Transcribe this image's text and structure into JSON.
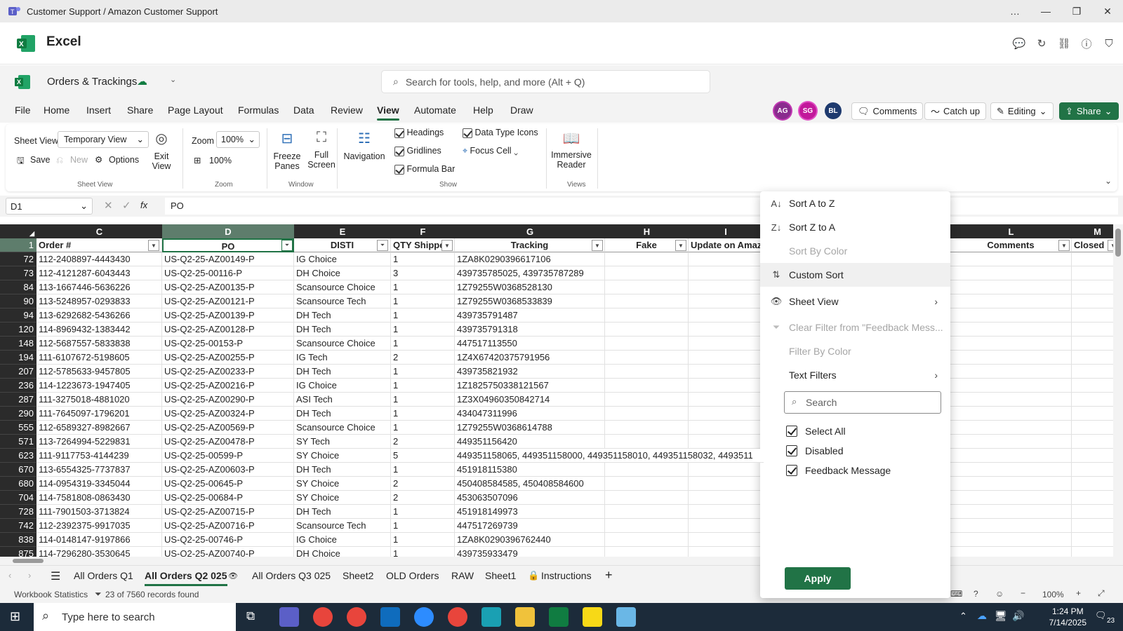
{
  "window": {
    "title": "Customer Support / Amazon Customer Support",
    "controls": [
      "…",
      "—",
      "❐",
      "✕"
    ]
  },
  "app": {
    "name": "Excel"
  },
  "doc": {
    "name": "Orders & Trackings",
    "search_placeholder": "Search for tools, help, and more (Alt + Q)"
  },
  "menu": [
    "File",
    "Home",
    "Insert",
    "Share",
    "Page Layout",
    "Formulas",
    "Data",
    "Review",
    "View",
    "Automate",
    "Help",
    "Draw"
  ],
  "menu_active": "View",
  "avatars": [
    {
      "initials": "AG",
      "color": "#8a2c8e"
    },
    {
      "initials": "SG",
      "color": "#c2199b"
    },
    {
      "initials": "BL",
      "color": "#1e3a6e"
    }
  ],
  "top_buttons": {
    "comments": "Comments",
    "catchup": "Catch up",
    "editing": "Editing",
    "share": "Share"
  },
  "ribbon": {
    "sheet_view_label": "Sheet View",
    "sheet_view_value": "Temporary View",
    "save": "Save",
    "new": "New",
    "options": "Options",
    "exit_view": [
      "Exit",
      "View"
    ],
    "sheet_view_group": "Sheet View",
    "zoom_label": "Zoom",
    "zoom_value": "100%",
    "zoom_100": "100%",
    "zoom_group": "Zoom",
    "freeze": [
      "Freeze",
      "Panes"
    ],
    "fullscreen": [
      "Full",
      "Screen"
    ],
    "window_group": "Window",
    "navigation": "Navigation",
    "headings": "Headings",
    "gridlines": "Gridlines",
    "formula_bar": "Formula Bar",
    "data_type_icons": "Data Type Icons",
    "focus_cell": "Focus Cell",
    "show_group": "Show",
    "immersive": [
      "Immersive",
      "Reader"
    ],
    "views_group": "Views"
  },
  "formula_bar": {
    "name_box": "D1",
    "fx": "fx",
    "value": "PO"
  },
  "columns": [
    {
      "letter": "C",
      "header": "Order #"
    },
    {
      "letter": "D",
      "header": "PO"
    },
    {
      "letter": "E",
      "header": "DISTI"
    },
    {
      "letter": "F",
      "header": "QTY Shipped"
    },
    {
      "letter": "G",
      "header": "Tracking"
    },
    {
      "letter": "H",
      "header": "Fake"
    },
    {
      "letter": "I",
      "header": "Update on Amaz"
    },
    {
      "letter": "L",
      "header": "Comments"
    },
    {
      "letter": "M",
      "header": "Closed"
    }
  ],
  "header_row_num": "1",
  "rows": [
    {
      "n": "72",
      "order": "112-2408897-4443430",
      "po": "US-Q2-25-AZ00149-P",
      "disti": "IG Choice",
      "qty": "1",
      "tracking": "1ZA8K0290396617106"
    },
    {
      "n": "73",
      "order": "112-4121287-6043443",
      "po": "US-Q2-25-00116-P",
      "disti": "DH Choice",
      "qty": "3",
      "tracking": "439735785025, 439735787289"
    },
    {
      "n": "84",
      "order": "113-1667446-5636226",
      "po": "US-Q2-25-AZ00135-P",
      "disti": "Scansource Choice",
      "qty": "1",
      "tracking": "1Z79255W0368528130"
    },
    {
      "n": "90",
      "order": "113-5248957-0293833",
      "po": "US-Q2-25-AZ00121-P",
      "disti": "Scansource Tech",
      "qty": "1",
      "tracking": "1Z79255W0368533839"
    },
    {
      "n": "94",
      "order": "113-6292682-5436266",
      "po": "US-Q2-25-AZ00139-P",
      "disti": "DH Tech",
      "qty": "1",
      "tracking": "439735791487"
    },
    {
      "n": "120",
      "order": "114-8969432-1383442",
      "po": "US-Q2-25-AZ00128-P",
      "disti": "DH Tech",
      "qty": "1",
      "tracking": "439735791318"
    },
    {
      "n": "148",
      "order": "112-5687557-5833838",
      "po": "US-Q2-25-00153-P",
      "disti": "Scansource Choice",
      "qty": "1",
      "tracking": "447517113550"
    },
    {
      "n": "194",
      "order": "111-6107672-5198605",
      "po": "US-Q2-25-AZ00255-P",
      "disti": "IG Tech",
      "qty": "2",
      "tracking": "1Z4X67420375791956"
    },
    {
      "n": "207",
      "order": "112-5785633-9457805",
      "po": "US-Q2-25-AZ00233-P",
      "disti": "DH Tech",
      "qty": "1",
      "tracking": "439735821932"
    },
    {
      "n": "236",
      "order": "114-1223673-1947405",
      "po": "US-Q2-25-AZ00216-P",
      "disti": "IG Choice",
      "qty": "1",
      "tracking": "1Z1825750338121567"
    },
    {
      "n": "287",
      "order": "111-3275018-4881020",
      "po": "US-Q2-25-AZ00290-P",
      "disti": "ASI Tech",
      "qty": "1",
      "tracking": "1Z3X04960350842714"
    },
    {
      "n": "290",
      "order": "111-7645097-1796201",
      "po": "US-Q2-25-AZ00324-P",
      "disti": "DH Tech",
      "qty": "1",
      "tracking": "434047311996"
    },
    {
      "n": "555",
      "order": "112-6589327-8982667",
      "po": "US-Q2-25-AZ00569-P",
      "disti": "Scansource Choice",
      "qty": "1",
      "tracking": "1Z79255W0368614788"
    },
    {
      "n": "571",
      "order": "113-7264994-5229831",
      "po": "US-Q2-25-AZ00478-P",
      "disti": "SY Tech",
      "qty": "2",
      "tracking": "449351156420"
    },
    {
      "n": "623",
      "order": "111-9117753-4144239",
      "po": "US-Q2-25-00599-P",
      "disti": "SY Choice",
      "qty": "5",
      "tracking": "449351158065, 449351158000, 449351158010, 449351158032, 4493511"
    },
    {
      "n": "670",
      "order": "113-6554325-7737837",
      "po": "US-Q2-25-AZ00603-P",
      "disti": "DH Tech",
      "qty": "1",
      "tracking": "451918115380"
    },
    {
      "n": "680",
      "order": "114-0954319-3345044",
      "po": "US-Q2-25-00645-P",
      "disti": "SY Choice",
      "qty": "2",
      "tracking": "450408584585, 450408584600"
    },
    {
      "n": "704",
      "order": "114-7581808-0863430",
      "po": "US-Q2-25-00684-P",
      "disti": "SY Choice",
      "qty": "2",
      "tracking": "453063507096"
    },
    {
      "n": "728",
      "order": "111-7901503-3713824",
      "po": "US-Q2-25-AZ00715-P",
      "disti": "DH Tech",
      "qty": "1",
      "tracking": "451918149973"
    },
    {
      "n": "742",
      "order": "112-2392375-9917035",
      "po": "US-Q2-25-AZ00716-P",
      "disti": "Scansource Tech",
      "qty": "1",
      "tracking": "447517269739"
    },
    {
      "n": "838",
      "order": "114-0148147-9197866",
      "po": "US-Q2-25-00746-P",
      "disti": "IG Choice",
      "qty": "1",
      "tracking": "1ZA8K0290396762440"
    },
    {
      "n": "875",
      "order": "114-7296280-3530645",
      "po": "US-Q2-25-AZ00740-P",
      "disti": "DH Choice",
      "qty": "1",
      "tracking": "439735933479"
    }
  ],
  "filter_menu": {
    "sort_az": "Sort A to Z",
    "sort_za": "Sort Z to A",
    "sort_color": "Sort By Color",
    "custom_sort": "Custom Sort",
    "sheet_view": "Sheet View",
    "clear_filter": "Clear Filter from \"Feedback Mess...",
    "filter_color": "Filter By Color",
    "text_filters": "Text Filters",
    "search_placeholder": "Search",
    "options": [
      "Select All",
      "Disabled",
      "Feedback Message"
    ],
    "apply": "Apply"
  },
  "sheet_tabs": [
    "All Orders Q1",
    "All Orders Q2 025",
    "All Orders Q3 025",
    "Sheet2",
    "OLD Orders",
    "RAW",
    "Sheet1",
    "Instructions"
  ],
  "active_tab": "All Orders Q2 025",
  "status": {
    "stats": "Workbook Statistics",
    "records": "23 of 7560 records found",
    "zoom": "100%"
  },
  "taskbar": {
    "search_placeholder": "Type here to search",
    "time": "1:24 PM",
    "date": "7/14/2025",
    "notif": "23"
  }
}
